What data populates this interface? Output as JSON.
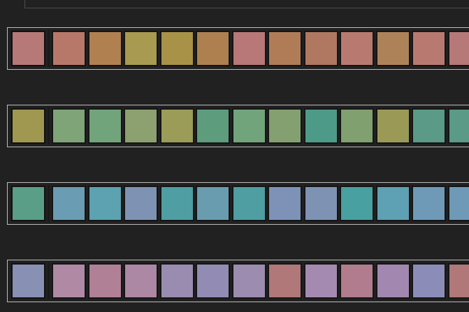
{
  "rows": [
    {
      "key": "row-red-orange",
      "selected": "#b77878",
      "swatches": [
        "#b7786a",
        "#b08050",
        "#a89a50",
        "#a89248",
        "#ae8050",
        "#b87878",
        "#b07c58",
        "#b07860",
        "#b87a70",
        "#ae8258",
        "#b87a70",
        "#b77878"
      ]
    },
    {
      "key": "row-yellow-green",
      "selected": "#a09850",
      "swatches": [
        "#7ea478",
        "#72a47c",
        "#8ca070",
        "#9a9c58",
        "#5e9c7e",
        "#72a47c",
        "#84a070",
        "#4e9a88",
        "#80a070",
        "#9a9a56",
        "#5a9a86",
        "#5a9a86"
      ]
    },
    {
      "key": "row-teal-blue",
      "selected": "#5a9e88",
      "swatches": [
        "#6a9cb4",
        "#5ca2b0",
        "#7e92b4",
        "#4e9ea4",
        "#6a9cb0",
        "#4e9ea2",
        "#7e92b8",
        "#7e92b4",
        "#48a0a0",
        "#5ea0b4",
        "#6e9ab8",
        "#6e9ab8"
      ]
    },
    {
      "key": "row-violet-pink",
      "selected": "#8890b4",
      "swatches": [
        "#b08aa4",
        "#b08096",
        "#ac88a4",
        "#9a8cb0",
        "#928cb4",
        "#9c8cb0",
        "#b07878",
        "#a48ab0",
        "#b07c8e",
        "#a288b0",
        "#8c8cb8",
        "#b07878"
      ]
    }
  ]
}
